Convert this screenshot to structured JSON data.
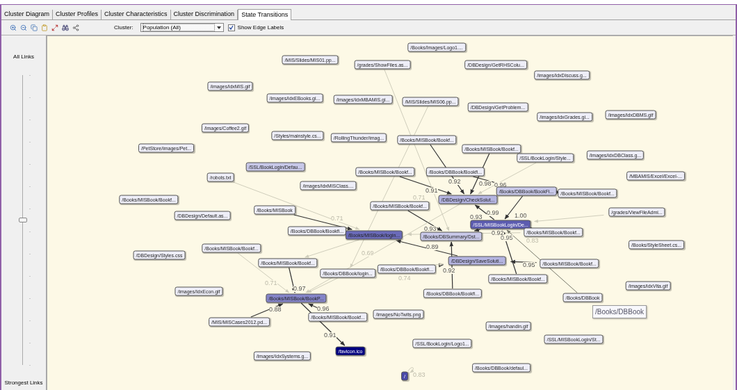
{
  "tabs": [
    {
      "label": "Cluster Diagram",
      "selected": false
    },
    {
      "label": "Cluster Profiles",
      "selected": false
    },
    {
      "label": "Cluster Characteristics",
      "selected": false
    },
    {
      "label": "Cluster Discrimination",
      "selected": false
    },
    {
      "label": "State Transitions",
      "selected": true
    }
  ],
  "cluster": {
    "label": "Cluster:",
    "value": "Population (All)"
  },
  "show_edge_labels": {
    "label": "Show Edge Labels",
    "checked": true
  },
  "link_slider": {
    "top_label": "All Links",
    "bottom_label": "Strongest Links",
    "level": 0.5
  },
  "nodes": [
    {
      "label": "/Books/Images/Logo1....",
      "color": "#eeeef8"
    },
    {
      "label": "/MIS/Slides/MIS01.pp...",
      "color": "#eeeef8"
    },
    {
      "label": "/grades/ShowFiles.as...",
      "color": "#eeeef8"
    },
    {
      "label": "/DBDesign/GetRHSColu...",
      "color": "#eeeef8"
    },
    {
      "label": "/images/idxDiscuss.g...",
      "color": "#eeeef8"
    },
    {
      "label": "/images/idxMIS.gif",
      "color": "#eeeef8"
    },
    {
      "label": "/images/idxEBooks.gi...",
      "color": "#eeeef8"
    },
    {
      "label": "/images/IdxMBAMIS.gi...",
      "color": "#eeeef8"
    },
    {
      "label": "/MIS/Slides/MIS06.pp...",
      "color": "#eeeef8"
    },
    {
      "label": "/DBDesign/GetProblem...",
      "color": "#eeeef8"
    },
    {
      "label": "/images/idxGrades.gi...",
      "color": "#eeeef8"
    },
    {
      "label": "/images/idxDBMS.gif",
      "color": "#eeeef8"
    },
    {
      "label": "/images/Coffee2.gif",
      "color": "#eeeef8"
    },
    {
      "label": "/Styles/mainstyle.cs...",
      "color": "#eeeef8"
    },
    {
      "label": "/RollingThunder/imag...",
      "color": "#eeeef8"
    },
    {
      "label": "/Books/MISBook/Bookf...",
      "color": "#eeeef8"
    },
    {
      "label": "/Books/MISBook/Bookf...",
      "color": "#eeeef8"
    },
    {
      "label": "/SSL/BookLogin/Style...",
      "color": "#eeeef8"
    },
    {
      "label": "/images/idxDBClass.g...",
      "color": "#eeeef8"
    },
    {
      "label": "/PetStore/images/Pet...",
      "color": "#eeeef8"
    },
    {
      "label": "/SSL/BookLogin/Defau...",
      "color": "#c8c8e8"
    },
    {
      "label": "/Books/MISBook/Bookf...",
      "color": "#eeeef8"
    },
    {
      "label": "/Books/DBBook/Bookfi...",
      "color": "#eeeef8"
    },
    {
      "label": "/robots.txt",
      "color": "#eeeef8"
    },
    {
      "label": "/images/idxMISClass....",
      "color": "#eeeef8"
    },
    {
      "label": "/MBAMIS/Excel/Excel-...",
      "color": "#eeeef8"
    },
    {
      "label": "/DBDesign/CheckSolut...",
      "color": "#b4b4e0"
    },
    {
      "label": "/Books/DBBook/BookFi...",
      "color": "#c8c8e8"
    },
    {
      "label": "/Books/MISBook/Bookf...",
      "color": "#eeeef8"
    },
    {
      "label": "/Books/MISBook/Bookf...",
      "color": "#eeeef8"
    },
    {
      "label": "/Books/MISBook/Bookf...",
      "color": "#eeeef8"
    },
    {
      "label": "/Books/MISBook",
      "color": "#eeeef8"
    },
    {
      "label": "/DBDesign/Default.as...",
      "color": "#eeeef8"
    },
    {
      "label": "/grades/ViewFileAdmi...",
      "color": "#eeeef8"
    },
    {
      "label": "/SSL/MISBookLogin/De...",
      "color": "#5c5cb0"
    },
    {
      "label": "/Books/DBBook/Bookfi...",
      "color": "#eeeef8"
    },
    {
      "label": "/Books/MISBook/login...",
      "color": "#6a6ab8"
    },
    {
      "label": "/Books/DBSummary/Dst...",
      "color": "#c8c8e8"
    },
    {
      "label": "/Books/MISBook/Bookf...",
      "color": "#eeeef8"
    },
    {
      "label": "/Books/MISBook/Bookf...",
      "color": "#eeeef8"
    },
    {
      "label": "/Books/StyleSheet.cs...",
      "color": "#eeeef8"
    },
    {
      "label": "/DBDesign/Styles.css",
      "color": "#eeeef8"
    },
    {
      "label": "/Books/MISBook/Bookf...",
      "color": "#eeeef8"
    },
    {
      "label": "/DBDesign/SaveSoluti...",
      "color": "#b4b4e0"
    },
    {
      "label": "/Books/MISBook/Bookf...",
      "color": "#eeeef8"
    },
    {
      "label": "/Books/DBBook/login...",
      "color": "#eeeef8"
    },
    {
      "label": "/Books/DBBook/Bookfi...",
      "color": "#eeeef8"
    },
    {
      "label": "/Books/MISBook/Bookf...",
      "color": "#eeeef8"
    },
    {
      "label": "/images/idxVita.gif",
      "color": "#eeeef8"
    },
    {
      "label": "/images/IdxEcon.gif",
      "color": "#eeeef8"
    },
    {
      "label": "/Books/MISBook/BookP...",
      "color": "#8484c8"
    },
    {
      "label": "/Books/DBBook/Bookfi...",
      "color": "#eeeef8"
    },
    {
      "label": "/Books/DBBook",
      "color": "#eeeef8"
    },
    {
      "label": "/MIS/MISCases2012.pd...",
      "color": "#eeeef8"
    },
    {
      "label": "/Books/MISBook/Bookf...",
      "color": "#eeeef8"
    },
    {
      "label": "/images/NoTwits.png",
      "color": "#eeeef8"
    },
    {
      "label": "/images/handin.gif",
      "color": "#eeeef8"
    },
    {
      "label": "/SSL/BookLogin/Logo1...",
      "color": "#eeeef8"
    },
    {
      "label": "/SSL/MISBookLogin/St...",
      "color": "#eeeef8"
    },
    {
      "label": "/images/IdxSystems.g...",
      "color": "#eeeef8"
    },
    {
      "label": "/favicon.ico",
      "color": "#000080"
    },
    {
      "label": "/Books/DBBook/defaul...",
      "color": "#eeeef8"
    },
    {
      "label": "/",
      "color": "#4a4aa8"
    }
  ],
  "edges": [
    {
      "label": "0.92",
      "kind": "strong"
    },
    {
      "label": "0.91",
      "kind": "strong"
    },
    {
      "label": "0.98",
      "kind": "strong"
    },
    {
      "label": "0.96",
      "kind": "strong"
    },
    {
      "label": "0.71",
      "kind": "weak"
    },
    {
      "label": "0.69",
      "kind": "weak"
    },
    {
      "label": "1.00",
      "kind": "strong"
    },
    {
      "kind": "strong"
    },
    {
      "kind": "weak"
    },
    {
      "kind": "weak"
    },
    {
      "label": "0.99",
      "kind": "strong"
    },
    {
      "label": "0.93",
      "kind": "strong"
    },
    {
      "label": "0.92",
      "kind": "strong"
    },
    {
      "label": "0.83",
      "kind": "weak"
    },
    {
      "label": "0.95",
      "kind": "strong"
    },
    {
      "label": "0.95",
      "kind": "medium"
    },
    {
      "kind": "strong"
    },
    {
      "label": "0.89",
      "kind": "strong"
    },
    {
      "label": "0.92",
      "kind": "strong"
    },
    {
      "kind": "strong"
    },
    {
      "label": "0.93",
      "kind": "strong"
    },
    {
      "kind": "strong"
    },
    {
      "kind": "strong"
    },
    {
      "kind": "weak"
    },
    {
      "label": "0.97",
      "kind": "strong"
    },
    {
      "label": "0.88",
      "kind": "strong"
    },
    {
      "label": "0.96",
      "kind": "strong"
    },
    {
      "label": "0.91",
      "kind": "strong"
    },
    {
      "kind": "weak"
    },
    {
      "label": "0.74",
      "kind": "weak"
    },
    {
      "label": "0.71",
      "kind": "weak"
    },
    {
      "label": "0.71",
      "kind": "weak"
    },
    {
      "kind": "weak"
    },
    {
      "label": "0.83",
      "kind": "weak"
    }
  ],
  "tooltip": {
    "text": "/Books/DBBook"
  }
}
